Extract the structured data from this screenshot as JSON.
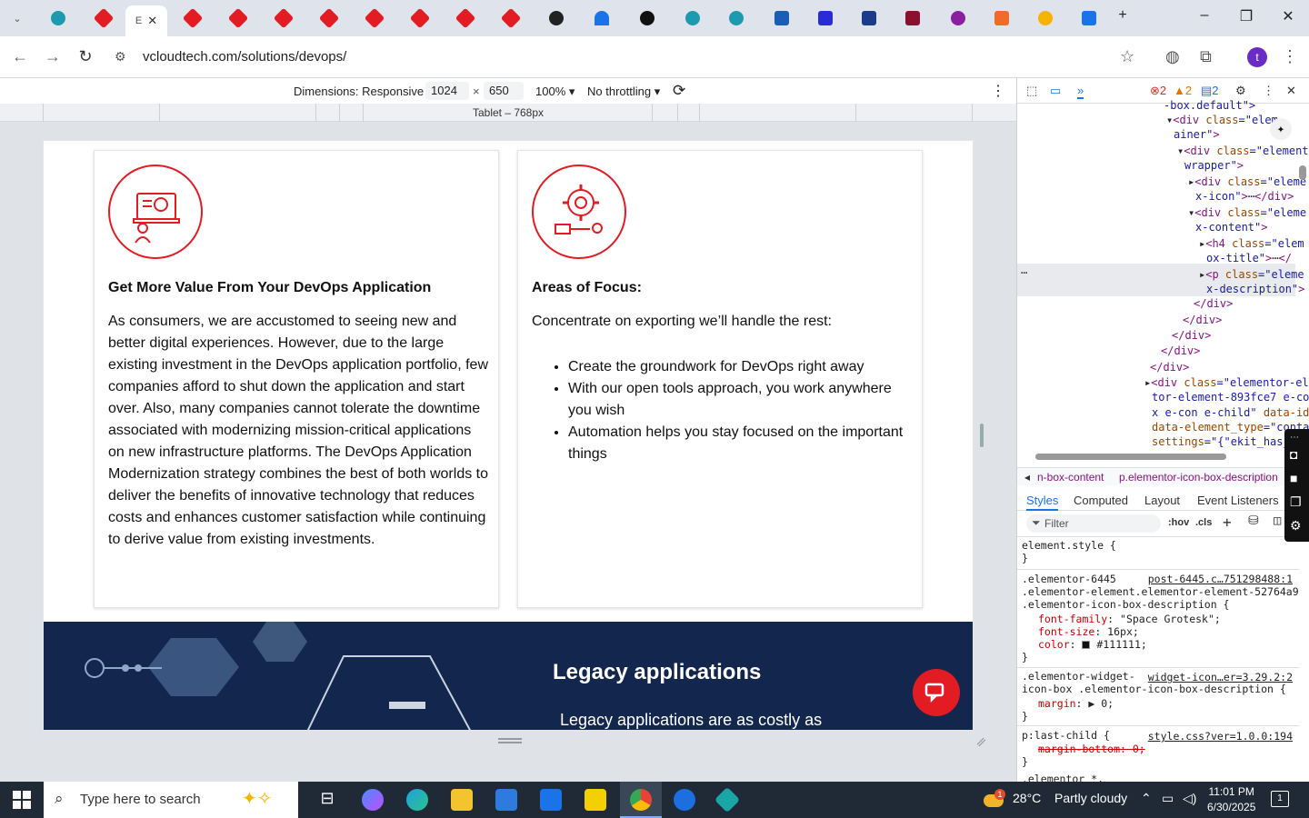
{
  "browser": {
    "active_tab_label": "E",
    "url": "vcloudtech.com/solutions/devops/",
    "avatar_letter": "t"
  },
  "device_toolbar": {
    "dimensions_label": "Dimensions: Responsive",
    "width": "1024",
    "height": "650",
    "zoom": "100%",
    "throttling": "No throttling",
    "ruler_label": "Tablet – 768px"
  },
  "page": {
    "card1": {
      "title": "Get More Value From Your DevOps Application",
      "body": "As consumers, we are accustomed to seeing new and better digital experiences. However, due to the large existing investment in the DevOps application portfolio, few companies afford to shut down the application and start over. Also, many companies cannot tolerate the downtime associated with modernizing mission-critical applications on new infrastructure platforms. The DevOps Application Modernization strategy combines the best of both worlds to deliver the benefits of innovative technology that reduces costs and enhances customer satisfaction while continuing to derive value from existing investments."
    },
    "card2": {
      "title": "Areas of Focus:",
      "intro": "Concentrate on exporting we’ll handle the rest:",
      "bullets": [
        "Create the groundwork for DevOps right away",
        "With our open tools approach, you work anywhere you wish",
        "Automation helps you stay focused on the important things"
      ]
    },
    "banner": {
      "title": "Legacy applications",
      "text": "Legacy applications are as costly as"
    },
    "accent_color": "#e31b23",
    "banner_color": "#13264d"
  },
  "devtools": {
    "errors": "2",
    "warnings": "2",
    "messages": "2",
    "dom_top": "-box.default\">",
    "breadcrumb1": "n-box-content",
    "breadcrumb2": "p.elementor-icon-box-description",
    "tabs": [
      "Styles",
      "Computed",
      "Layout",
      "Event Listeners"
    ],
    "filter_placeholder": "Filter",
    "hov": ":hov",
    "cls": ".cls",
    "rules": {
      "element_style": "element.style {",
      "r1_sel1": ".elementor-6445",
      "r1_link": "post-6445.c…751298488:1",
      "r1_sel2": ".elementor-element.elementor-element-52764a9",
      "r1_sel3": ".elementor-icon-box-description {",
      "r1_p1": "font-family",
      "r1_v1": "\"Space Grotesk\";",
      "r1_p2": "font-size",
      "r1_v2": "16px;",
      "r1_p3": "color",
      "r1_v3": "#111111;",
      "r2_sel1": ".elementor-widget-",
      "r2_link": "widget-icon…er=3.29.2:2",
      "r2_sel2": "icon-box .elementor-icon-box-description {",
      "r2_p1": "margin",
      "r2_v1": "▶ 0;",
      "r3_sel": "p:last-child {",
      "r3_link": "style.css?ver=1.0.0:194",
      "r3_p1": "margin-bottom: 0;",
      "r4_sel": ".elementor *,"
    }
  },
  "taskbar": {
    "search_placeholder": "Type here to search",
    "weather_temp": "28°C",
    "weather_text": "Partly cloudy",
    "time": "11:01 PM",
    "date": "6/30/2025",
    "notifications": "1"
  }
}
